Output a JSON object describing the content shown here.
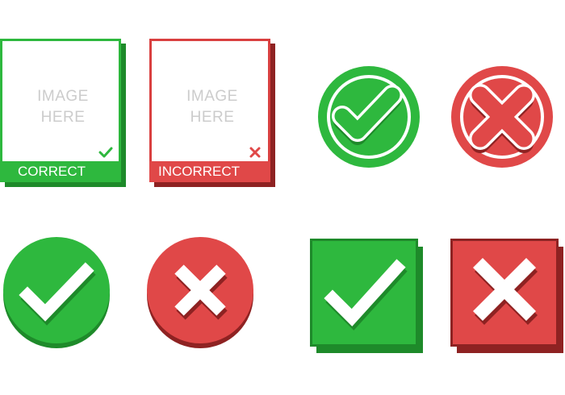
{
  "cards": [
    {
      "placeholder_line1": "IMAGE",
      "placeholder_line2": "HERE",
      "label": "CORRECT"
    },
    {
      "placeholder_line1": "IMAGE",
      "placeholder_line2": "HERE",
      "label": "INCORRECT"
    }
  ],
  "icons": [
    "check-card",
    "cross-card",
    "round-outlined-check-icon",
    "round-outlined-cross-icon",
    "round-check-icon",
    "round-cross-icon",
    "square-check-icon",
    "square-cross-icon"
  ],
  "colors": {
    "green": "#2eb83e",
    "green_dark": "#1e8a2a",
    "red": "#e04848",
    "red_dark": "#8e2222",
    "white": "#ffffff"
  }
}
